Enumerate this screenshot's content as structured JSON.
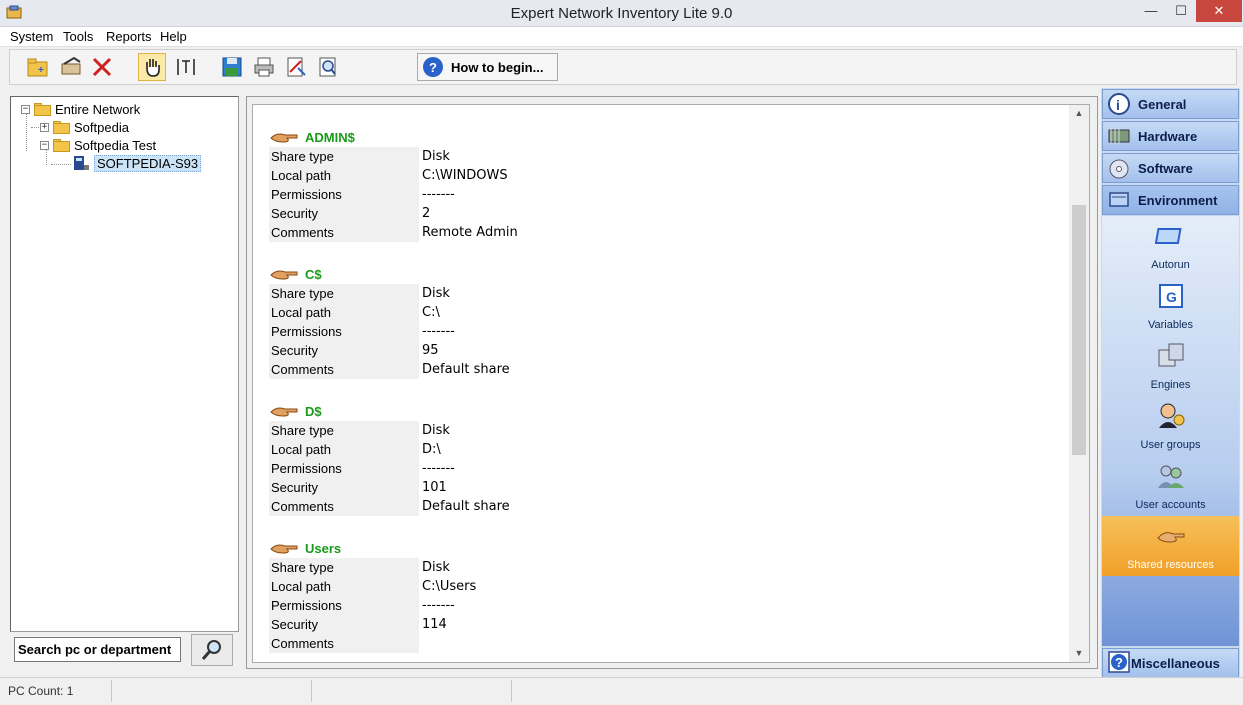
{
  "window": {
    "title": "Expert Network Inventory Lite 9.0",
    "minimize": "—",
    "maximize": "☐",
    "close": "✕"
  },
  "menu": [
    "System",
    "Tools",
    "Reports",
    "Help"
  ],
  "toolbar": {
    "howto_label": "How to begin..."
  },
  "tree": {
    "root": "Entire Network",
    "nodes": [
      "Softpedia",
      "Softpedia Test"
    ],
    "computer": "SOFTPEDIA-S93"
  },
  "search": {
    "label": "Search pc or department"
  },
  "shares": [
    {
      "name": "ADMIN$",
      "rows": [
        {
          "label": "Share type",
          "value": "Disk"
        },
        {
          "label": "Local path",
          "value": "C:\\WINDOWS"
        },
        {
          "label": "Permissions",
          "value": "-------"
        },
        {
          "label": "Security",
          "value": "2"
        },
        {
          "label": "Comments",
          "value": "Remote Admin"
        }
      ]
    },
    {
      "name": "C$",
      "rows": [
        {
          "label": "Share type",
          "value": "Disk"
        },
        {
          "label": "Local path",
          "value": "C:\\"
        },
        {
          "label": "Permissions",
          "value": "-------"
        },
        {
          "label": "Security",
          "value": "95"
        },
        {
          "label": "Comments",
          "value": "Default share"
        }
      ]
    },
    {
      "name": "D$",
      "rows": [
        {
          "label": "Share type",
          "value": "Disk"
        },
        {
          "label": "Local path",
          "value": "D:\\"
        },
        {
          "label": "Permissions",
          "value": "-------"
        },
        {
          "label": "Security",
          "value": "101"
        },
        {
          "label": "Comments",
          "value": "Default share"
        }
      ]
    },
    {
      "name": "Users",
      "rows": [
        {
          "label": "Share type",
          "value": "Disk"
        },
        {
          "label": "Local path",
          "value": "C:\\Users"
        },
        {
          "label": "Permissions",
          "value": "-------"
        },
        {
          "label": "Security",
          "value": "114"
        },
        {
          "label": "Comments",
          "value": ""
        }
      ]
    }
  ],
  "categories": {
    "general": "General",
    "hardware": "Hardware",
    "software": "Software",
    "environment": "Environment",
    "miscellaneous": "Miscellaneous"
  },
  "environment_items": [
    "Autorun",
    "Variables",
    "Engines",
    "User groups",
    "User accounts",
    "Shared resources"
  ],
  "status": {
    "pc_count": "PC Count: 1"
  },
  "colors": {
    "share_name": "#1a9a1a",
    "active_item": "#f0a028",
    "selected_node": "#cce4f7"
  }
}
